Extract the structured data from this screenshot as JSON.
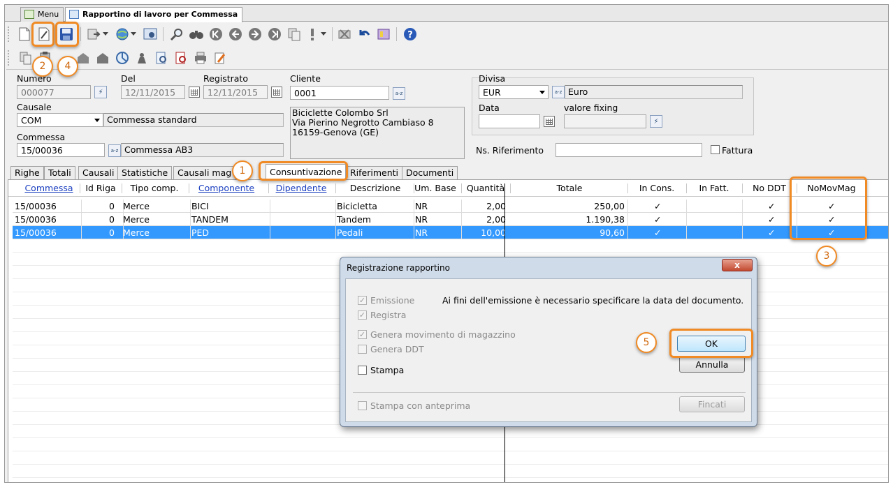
{
  "window_tabs": [
    {
      "label": "Menu"
    },
    {
      "label": "Rapportino di lavoro per Commessa"
    }
  ],
  "callouts": [
    "1",
    "2",
    "3",
    "4",
    "5"
  ],
  "form": {
    "numero": {
      "label": "Numero",
      "value": "000077"
    },
    "del": {
      "label": "Del",
      "value": "12/11/2015"
    },
    "registrato": {
      "label": "Registrato",
      "value": "12/11/2015"
    },
    "cliente": {
      "label": "Cliente",
      "value": "0001",
      "address_lines": [
        "Biciclette Colombo Srl",
        "Via Pierino Negrotto Cambiaso 8",
        "16159-Genova (GE)"
      ]
    },
    "causale": {
      "label": "Causale",
      "value": "COM",
      "description": "Commessa standard"
    },
    "commessa": {
      "label": "Commessa",
      "value": "15/00036",
      "description": "Commessa AB3"
    },
    "divisa": {
      "label": "Divisa",
      "value": "EUR",
      "description": "Euro"
    },
    "data": {
      "label": "Data",
      "value": ""
    },
    "valore_fixing": {
      "label": "valore fixing",
      "value": ""
    },
    "ns_riferimento": {
      "label": "Ns. Riferimento",
      "value": ""
    },
    "fattura": {
      "label": "Fattura",
      "checked": false
    }
  },
  "sub_tabs": [
    {
      "label": "Righe"
    },
    {
      "label": "Totali"
    },
    {
      "label": "Causali"
    },
    {
      "label": "Statistiche"
    },
    {
      "label": "Causali mag"
    },
    {
      "label": "Consuntivazione"
    },
    {
      "label": "Riferimenti"
    },
    {
      "label": "Documenti"
    }
  ],
  "grid": {
    "headers": [
      "Commessa",
      "Id Riga",
      "Tipo comp.",
      "Componente",
      "Dipendente",
      "Descrizione",
      "Um. Base",
      "Quantità",
      "Totale",
      "In Cons.",
      "In Fatt.",
      "No DDT",
      "NoMovMag"
    ],
    "rows": [
      {
        "commessa": "15/00036",
        "id_riga": "0",
        "tipo": "Merce",
        "componente": "BICI",
        "dipendente": "",
        "descrizione": "Bicicletta",
        "um": "NR",
        "quantita": "2,00",
        "totale": "250,00",
        "in_cons": "✓",
        "in_fatt": "",
        "no_ddt": "✓",
        "nomovmag": "✓"
      },
      {
        "commessa": "15/00036",
        "id_riga": "0",
        "tipo": "Merce",
        "componente": "TANDEM",
        "dipendente": "",
        "descrizione": "Tandem",
        "um": "NR",
        "quantita": "2,00",
        "totale": "1.190,38",
        "in_cons": "✓",
        "in_fatt": "",
        "no_ddt": "✓",
        "nomovmag": "✓"
      },
      {
        "commessa": "15/00036",
        "id_riga": "0",
        "tipo": "Merce",
        "componente": "PED",
        "dipendente": "",
        "descrizione": "Pedali",
        "um": "NR",
        "quantita": "10,00",
        "totale": "90,60",
        "in_cons": "✓",
        "in_fatt": "",
        "no_ddt": "✓",
        "nomovmag": "✓"
      }
    ]
  },
  "dialog": {
    "title": "Registrazione rapportino",
    "close": "x",
    "message": "Ai fini dell'emissione è necessario specificare la data del documento.",
    "options": {
      "emissione": "Emissione",
      "registra": "Registra",
      "genera_movimento": "Genera movimento di magazzino",
      "genera_ddt": "Genera DDT",
      "stampa": "Stampa",
      "stampa_anteprima": "Stampa con anteprima"
    },
    "check_mark": "✓",
    "buttons": {
      "ok": "OK",
      "annulla": "Annulla",
      "fincati": "Fincati"
    }
  },
  "colors": {
    "accent_orange": "#f08a24",
    "selection_blue": "#3399ff",
    "link_blue": "#1a3ec0"
  },
  "toolbar_icons": {
    "row1": [
      "new-document-icon",
      "edit-document-icon",
      "save-icon",
      "export-icon",
      "globe-icon",
      "settings-icon",
      "find-icon",
      "binoculars-icon",
      "first-record-icon",
      "previous-record-icon",
      "next-record-icon",
      "last-record-icon",
      "copy-record-icon",
      "warning-icon",
      "delete-icon",
      "undo-icon",
      "dependencies-icon",
      "help-icon"
    ],
    "row2": [
      "copy-icon",
      "paste-icon",
      "building-icon",
      "building-icon",
      "pie-chart-icon",
      "person-icon",
      "preview-icon",
      "pdf-icon",
      "print-icon",
      "edit-icon"
    ]
  }
}
